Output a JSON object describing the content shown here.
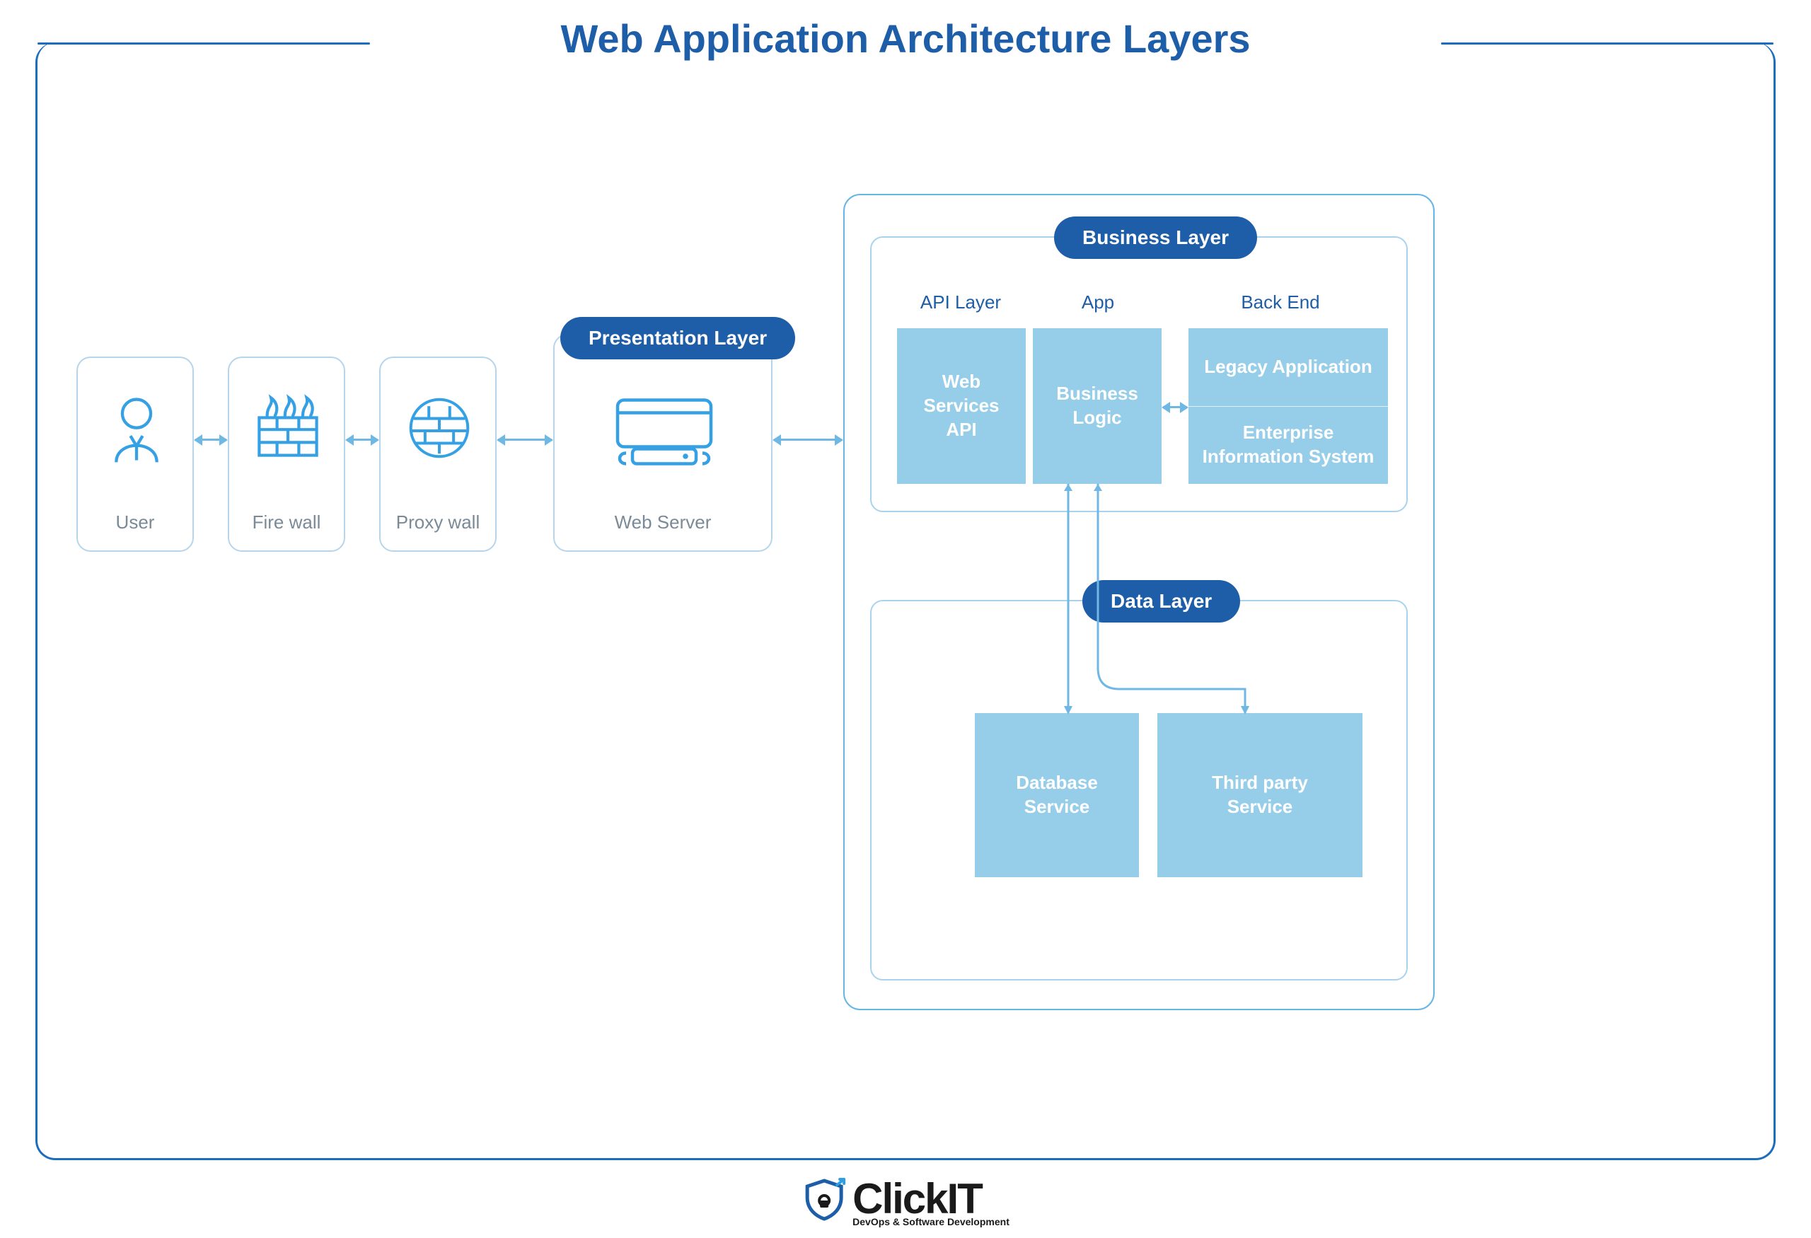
{
  "title": "Web Application Architecture Layers",
  "nodes": {
    "user": "User",
    "firewall": "Fire wall",
    "proxy": "Proxy wall",
    "webserver": "Web Server"
  },
  "pills": {
    "presentation": "Presentation Layer",
    "business": "Business Layer",
    "data": "Data Layer"
  },
  "sub_heads": {
    "api": "API Layer",
    "app": "App",
    "backend": "Back End"
  },
  "blocks": {
    "web_services_api": "Web\nServices\nAPI",
    "business_logic": "Business\nLogic",
    "legacy_app": "Legacy Application",
    "eis": "Enterprise\nInformation System",
    "db_service": "Database\nService",
    "third_party": "Third party\nService"
  },
  "logo": {
    "name": "ClickIT",
    "tagline": "DevOps & Software Development"
  }
}
